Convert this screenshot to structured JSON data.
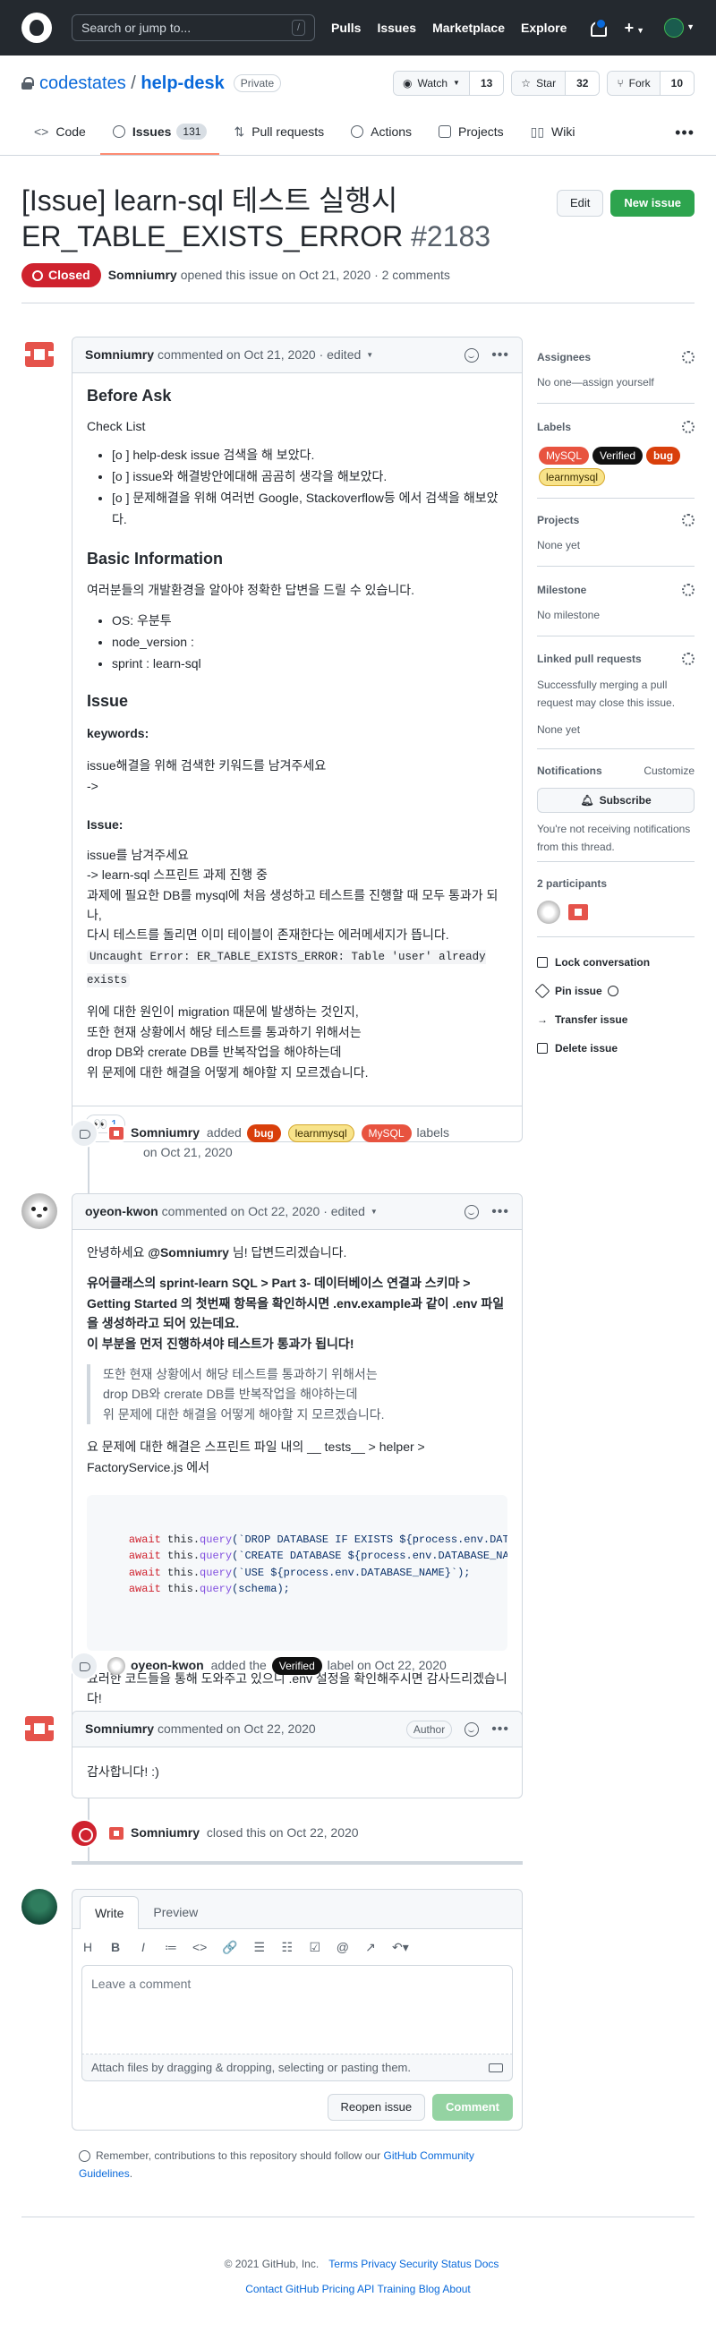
{
  "header": {
    "search_placeholder": "Search or jump to...",
    "search_key": "/",
    "nav": [
      "Pulls",
      "Issues",
      "Marketplace",
      "Explore"
    ]
  },
  "repo": {
    "owner": "codestates",
    "sep": "/",
    "name": "help-desk",
    "visibility": "Private",
    "watch_label": "Watch",
    "watch_count": "13",
    "star_label": "Star",
    "star_count": "32",
    "fork_label": "Fork",
    "fork_count": "10"
  },
  "tabs": [
    {
      "label": "Code"
    },
    {
      "label": "Issues",
      "count": "131"
    },
    {
      "label": "Pull requests"
    },
    {
      "label": "Actions"
    },
    {
      "label": "Projects"
    },
    {
      "label": "Wiki"
    }
  ],
  "issue": {
    "title_line1": "[Issue] learn-sql 테스트 실행시",
    "title_line2": "ER_TABLE_EXISTS_ERROR ",
    "number": "#2183",
    "edit_label": "Edit",
    "new_issue_label": "New issue",
    "state": "Closed",
    "author": "Somniumry",
    "meta_text": "opened this issue on Oct 21, 2020 · 2 comments"
  },
  "comment1": {
    "author": "Somniumry",
    "meta": "commented on Oct 21, 2020 · edited",
    "h_before": "Before Ask",
    "h_check": "Check List",
    "checks": [
      "[o ] help-desk issue 검색을 해 보았다.",
      "[o ] issue와 해결방안에대해 곰곰히 생각을 해보았다.",
      "[o ] 문제해결을 위해 여러번 Google, Stackoverflow등 에서 검색을 해보았다."
    ],
    "h_basic": "Basic Information",
    "basic_text": "여러분들의 개발환경을 알아야 정확한 답변을 드릴 수 있습니다.",
    "env": [
      "OS: 우분투",
      "node_version :",
      "sprint : learn-sql"
    ],
    "h_issue": "Issue",
    "h_keywords": "keywords:",
    "kw_line1": "issue해결을 위해 검색한 키워드를 남겨주세요",
    "kw_line2": "->",
    "h_issue2": "Issue:",
    "iss_line1": "issue를 남겨주세요",
    "iss_line2": "-> learn-sql 스프린트 과제 진행 중",
    "iss_line3": "과제에 필요한 DB를 mysql에 처음 생성하고 테스트를 진행할 때 모두 통과가 되나,",
    "iss_line4": "다시 테스트를 돌리면 이미 테이블이 존재한다는 에러메세지가 뜹니다.",
    "iss_code": "Uncaught Error: ER_TABLE_EXISTS_ERROR: Table 'user' already exists",
    "p_line1": "위에 대한 원인이 migration 때문에 발생하는 것인지,",
    "p_line2": "또한 현재 상황에서 해당 테스트를 통과하기 위해서는",
    "p_line3": "drop DB와 crerate DB를 반복작업을 해야하는데",
    "p_line4": "위 문제에 대한 해결을 어떻게 해야할 지 모르겠습니다.",
    "reaction_emoji": "👀",
    "reaction_count": "1"
  },
  "event_labels": {
    "author": "Somniumry",
    "verb": "added",
    "labels": [
      "bug",
      "learnmysql",
      "MySQL"
    ],
    "suffix": "labels",
    "date": "on Oct 21, 2020"
  },
  "comment2": {
    "author": "oyeon-kwon",
    "meta": "commented on Oct 22, 2020 · edited",
    "greet_pre": "안녕하세요 ",
    "greet_mention": "@Somniumry",
    "greet_post": " 님! 답변드리겠습니다.",
    "bold_line1": "유어클래스의 sprint-learn SQL > Part 3- 데이터베이스 연결과 스키마 > Getting Started 의 첫번째 항목을 확인하시면 .env.example과 같이 .env 파일을 생성하라고 되어 있는데요.",
    "bold_line2": "이 부분을 먼저 진행하셔야 테스트가 통과가 됩니다!",
    "quote_line1": "또한 현재 상황에서 해당 테스트를 통과하기 위해서는",
    "quote_line2": "drop DB와 crerate DB를 반복작업을 해야하는데",
    "quote_line3": "위 문제에 대한 해결을 어떻게 해야할 지 모르겠습니다.",
    "path_line": "요 문제에 대한 해결은 스프린트 파일 내의 __ tests__ > helper > FactoryService.js 에서",
    "code": [
      {
        "kw": "await",
        "rest1": " this.",
        "fn": "query",
        "str": "(`DROP DATABASE IF EXISTS ${process.env.DATABASE_NAME}`);"
      },
      {
        "kw": "await",
        "rest1": " this.",
        "fn": "query",
        "str": "(`CREATE DATABASE ${process.env.DATABASE_NAME}`);"
      },
      {
        "kw": "await",
        "rest1": " this.",
        "fn": "query",
        "str": "(`USE ${process.env.DATABASE_NAME}`);"
      },
      {
        "kw": "await",
        "rest1": " this.",
        "fn": "query",
        "str": "(schema);"
      }
    ],
    "end_line": "요러한 코드들을 통해 도와주고 있으니 .env 설정을 확인해주시면 감사드리겠습니다!"
  },
  "event_verified": {
    "author": "oyeon-kwon",
    "verb": "added the",
    "label": "Verified",
    "suffix": "label on Oct 22, 2020"
  },
  "comment3": {
    "author": "Somniumry",
    "meta": "commented on Oct 22, 2020",
    "badge": "Author",
    "body": "감사합니다! :)"
  },
  "event_closed": {
    "author": "Somniumry",
    "text": "closed this on Oct 22, 2020"
  },
  "composer": {
    "tab_write": "Write",
    "tab_preview": "Preview",
    "tools": [
      "H",
      "B",
      "I",
      "≔",
      "<>",
      "🔗",
      "☰",
      "☷",
      "☑",
      "@",
      "↗",
      "↶▾"
    ],
    "placeholder": "Leave a comment",
    "attach_text": "Attach files by dragging & dropping, selecting or pasting them.",
    "reopen_label": "Reopen issue",
    "comment_label": "Comment",
    "guide_text": "Remember, contributions to this repository should follow our ",
    "guide_link": "GitHub Community Guidelines",
    "guide_end": "."
  },
  "sidebar": {
    "assignees_title": "Assignees",
    "assignees_text": "No one—",
    "assignees_link": "assign yourself",
    "labels_title": "Labels",
    "labels": [
      "MySQL",
      "Verified",
      "bug",
      "learnmysql"
    ],
    "projects_title": "Projects",
    "projects_text": "None yet",
    "milestone_title": "Milestone",
    "milestone_text": "No milestone",
    "linked_title": "Linked pull requests",
    "linked_text": "Successfully merging a pull request may close this issue.",
    "linked_none": "None yet",
    "notif_title": "Notifications",
    "notif_customize": "Customize",
    "subscribe_label": "Subscribe",
    "notif_text": "You're not receiving notifications from this thread.",
    "participants_title": "2 participants",
    "actions": [
      "Lock conversation",
      "Pin issue",
      "Transfer issue",
      "Delete issue"
    ]
  },
  "footer": {
    "copyright": "© 2021 GitHub, Inc.",
    "row1": [
      "Terms",
      "Privacy",
      "Security",
      "Status",
      "Docs"
    ],
    "row2": [
      "Contact GitHub",
      "Pricing",
      "API",
      "Training",
      "Blog",
      "About"
    ]
  }
}
